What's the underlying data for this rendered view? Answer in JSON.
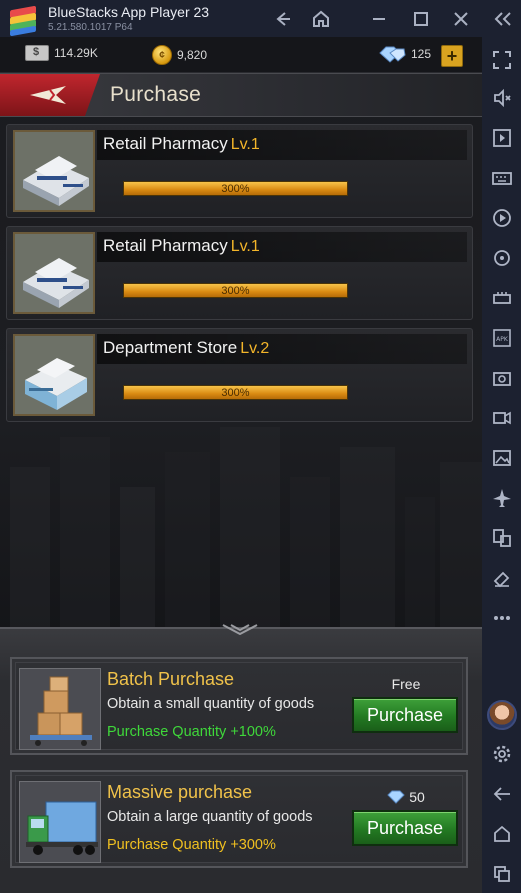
{
  "window": {
    "title": "BlueStacks App Player 23",
    "version": "5.21.580.1017",
    "arch": "P64"
  },
  "resources": {
    "cash": "114.29K",
    "coins": "9,820",
    "diamonds": "125"
  },
  "header": {
    "title": "Purchase"
  },
  "properties": [
    {
      "name": "Retail Pharmacy",
      "level": "Lv.1",
      "progress_label": "300%",
      "progress": 1.0
    },
    {
      "name": "Retail Pharmacy",
      "level": "Lv.1",
      "progress_label": "300%",
      "progress": 1.0
    },
    {
      "name": "Department Store",
      "level": "Lv.2",
      "progress_label": "300%",
      "progress": 1.0
    }
  ],
  "options": [
    {
      "title": "Batch Purchase",
      "description": "Obtain a small quantity of goods",
      "quantity": "Purchase Quantity +100%",
      "quantity_color": "#3fd83a",
      "cost": "Free",
      "button": "Purchase"
    },
    {
      "title": "Massive purchase",
      "description": "Obtain a large quantity of goods",
      "quantity": "Purchase Quantity +300%",
      "quantity_color": "#f0c020",
      "cost": "50",
      "button": "Purchase"
    }
  ]
}
